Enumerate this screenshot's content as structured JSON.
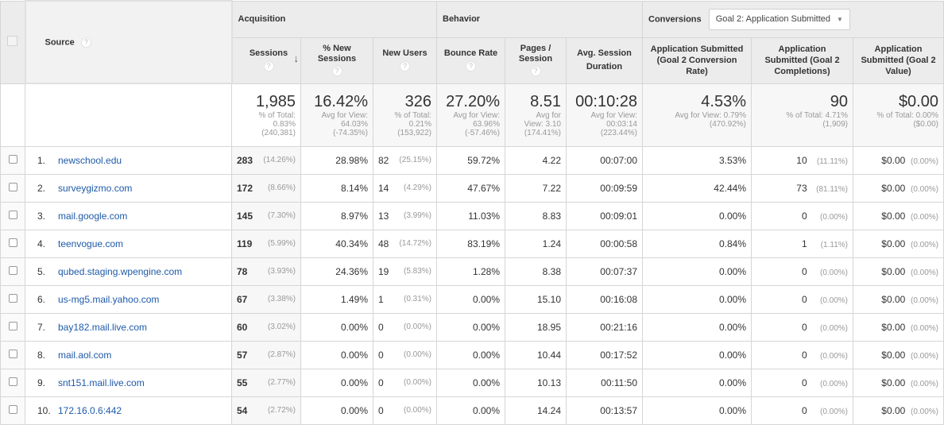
{
  "header": {
    "source_label": "Source",
    "groups": {
      "acquisition": "Acquisition",
      "behavior": "Behavior",
      "conversions": "Conversions"
    },
    "goal_selector": {
      "selected": "Goal 2: Application Submitted"
    },
    "columns": {
      "sessions": "Sessions",
      "pct_new_sessions": "% New Sessions",
      "new_users": "New Users",
      "bounce_rate": "Bounce Rate",
      "pages_session": "Pages / Session",
      "avg_duration": "Avg. Session Duration",
      "conv_rate": "Application Submitted (Goal 2 Conversion Rate)",
      "completions": "Application Submitted (Goal 2 Completions)",
      "value": "Application Submitted (Goal 2 Value)"
    },
    "help_glyph": "?",
    "sort_glyph": "↓"
  },
  "totals": {
    "sessions": {
      "value": "1,985",
      "l1": "% of Total:",
      "l2": "0.83%",
      "l3": "(240,381)"
    },
    "pct_new_sessions": {
      "value": "16.42%",
      "l1": "Avg for View:",
      "l2": "64.03%",
      "l3": "(-74.35%)"
    },
    "new_users": {
      "value": "326",
      "l1": "% of Total:",
      "l2": "0.21%",
      "l3": "(153,922)"
    },
    "bounce_rate": {
      "value": "27.20%",
      "l1": "Avg for View:",
      "l2": "63.96%",
      "l3": "(-57.46%)"
    },
    "pages_session": {
      "value": "8.51",
      "l1": "Avg for",
      "l2": "View: 3.10",
      "l3": "(174.41%)"
    },
    "avg_duration": {
      "value": "00:10:28",
      "l1": "Avg for View:",
      "l2": "00:03:14",
      "l3": "(223.44%)"
    },
    "conv_rate": {
      "value": "4.53%",
      "l1": "Avg for View: 0.79%",
      "l2": "(470.92%)"
    },
    "completions": {
      "value": "90",
      "l1": "% of Total: 4.71%",
      "l2": "(1,909)"
    },
    "value": {
      "value": "$0.00",
      "l1": "% of Total: 0.00%",
      "l2": "($0.00)"
    }
  },
  "rows": [
    {
      "idx": "1.",
      "source": "newschool.edu",
      "sessions": "283",
      "sessions_pct": "(14.26%)",
      "pct_new": "28.98%",
      "new_users": "82",
      "new_users_pct": "(25.15%)",
      "bounce": "59.72%",
      "pages": "4.22",
      "duration": "00:07:00",
      "conv_rate": "3.53%",
      "completions": "10",
      "completions_pct": "(11.11%)",
      "value": "$0.00",
      "value_pct": "(0.00%)"
    },
    {
      "idx": "2.",
      "source": "surveygizmo.com",
      "sessions": "172",
      "sessions_pct": "(8.66%)",
      "pct_new": "8.14%",
      "new_users": "14",
      "new_users_pct": "(4.29%)",
      "bounce": "47.67%",
      "pages": "7.22",
      "duration": "00:09:59",
      "conv_rate": "42.44%",
      "completions": "73",
      "completions_pct": "(81.11%)",
      "value": "$0.00",
      "value_pct": "(0.00%)"
    },
    {
      "idx": "3.",
      "source": "mail.google.com",
      "sessions": "145",
      "sessions_pct": "(7.30%)",
      "pct_new": "8.97%",
      "new_users": "13",
      "new_users_pct": "(3.99%)",
      "bounce": "11.03%",
      "pages": "8.83",
      "duration": "00:09:01",
      "conv_rate": "0.00%",
      "completions": "0",
      "completions_pct": "(0.00%)",
      "value": "$0.00",
      "value_pct": "(0.00%)"
    },
    {
      "idx": "4.",
      "source": "teenvogue.com",
      "sessions": "119",
      "sessions_pct": "(5.99%)",
      "pct_new": "40.34%",
      "new_users": "48",
      "new_users_pct": "(14.72%)",
      "bounce": "83.19%",
      "pages": "1.24",
      "duration": "00:00:58",
      "conv_rate": "0.84%",
      "completions": "1",
      "completions_pct": "(1.11%)",
      "value": "$0.00",
      "value_pct": "(0.00%)"
    },
    {
      "idx": "5.",
      "source": "qubed.staging.wpengine.com",
      "sessions": "78",
      "sessions_pct": "(3.93%)",
      "pct_new": "24.36%",
      "new_users": "19",
      "new_users_pct": "(5.83%)",
      "bounce": "1.28%",
      "pages": "8.38",
      "duration": "00:07:37",
      "conv_rate": "0.00%",
      "completions": "0",
      "completions_pct": "(0.00%)",
      "value": "$0.00",
      "value_pct": "(0.00%)"
    },
    {
      "idx": "6.",
      "source": "us-mg5.mail.yahoo.com",
      "sessions": "67",
      "sessions_pct": "(3.38%)",
      "pct_new": "1.49%",
      "new_users": "1",
      "new_users_pct": "(0.31%)",
      "bounce": "0.00%",
      "pages": "15.10",
      "duration": "00:16:08",
      "conv_rate": "0.00%",
      "completions": "0",
      "completions_pct": "(0.00%)",
      "value": "$0.00",
      "value_pct": "(0.00%)"
    },
    {
      "idx": "7.",
      "source": "bay182.mail.live.com",
      "sessions": "60",
      "sessions_pct": "(3.02%)",
      "pct_new": "0.00%",
      "new_users": "0",
      "new_users_pct": "(0.00%)",
      "bounce": "0.00%",
      "pages": "18.95",
      "duration": "00:21:16",
      "conv_rate": "0.00%",
      "completions": "0",
      "completions_pct": "(0.00%)",
      "value": "$0.00",
      "value_pct": "(0.00%)"
    },
    {
      "idx": "8.",
      "source": "mail.aol.com",
      "sessions": "57",
      "sessions_pct": "(2.87%)",
      "pct_new": "0.00%",
      "new_users": "0",
      "new_users_pct": "(0.00%)",
      "bounce": "0.00%",
      "pages": "10.44",
      "duration": "00:17:52",
      "conv_rate": "0.00%",
      "completions": "0",
      "completions_pct": "(0.00%)",
      "value": "$0.00",
      "value_pct": "(0.00%)"
    },
    {
      "idx": "9.",
      "source": "snt151.mail.live.com",
      "sessions": "55",
      "sessions_pct": "(2.77%)",
      "pct_new": "0.00%",
      "new_users": "0",
      "new_users_pct": "(0.00%)",
      "bounce": "0.00%",
      "pages": "10.13",
      "duration": "00:11:50",
      "conv_rate": "0.00%",
      "completions": "0",
      "completions_pct": "(0.00%)",
      "value": "$0.00",
      "value_pct": "(0.00%)"
    },
    {
      "idx": "10.",
      "source": "172.16.0.6:442",
      "sessions": "54",
      "sessions_pct": "(2.72%)",
      "pct_new": "0.00%",
      "new_users": "0",
      "new_users_pct": "(0.00%)",
      "bounce": "0.00%",
      "pages": "14.24",
      "duration": "00:13:57",
      "conv_rate": "0.00%",
      "completions": "0",
      "completions_pct": "(0.00%)",
      "value": "$0.00",
      "value_pct": "(0.00%)"
    }
  ]
}
